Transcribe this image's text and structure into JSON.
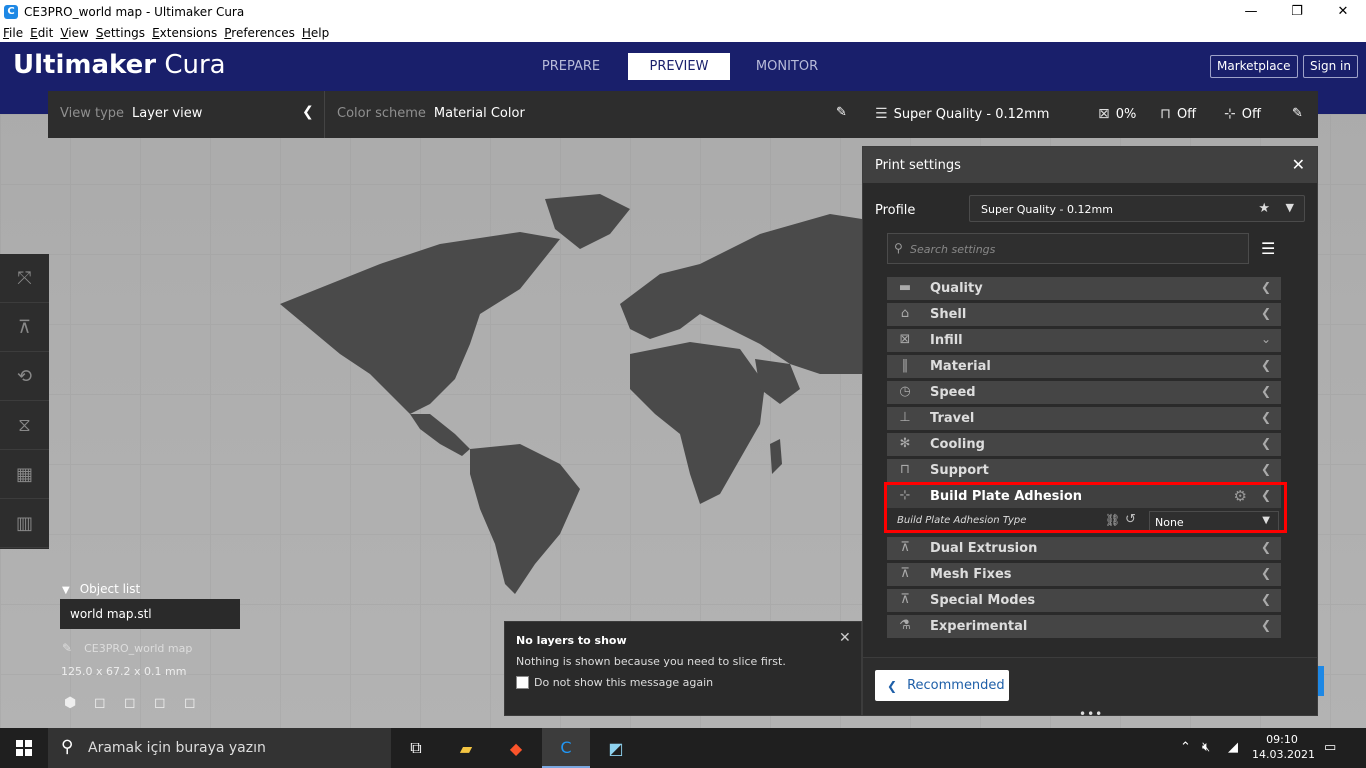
{
  "window": {
    "title": "CE3PRO_world map - Ultimaker Cura",
    "minimize": "—",
    "maximize": "❐",
    "close": "✕"
  },
  "menu": [
    "File",
    "Edit",
    "View",
    "Settings",
    "Extensions",
    "Preferences",
    "Help"
  ],
  "header": {
    "brand_bold": "Ultimaker",
    "brand_light": "Cura",
    "stages": [
      "PREPARE",
      "PREVIEW",
      "MONITOR"
    ],
    "active_stage": "PREVIEW",
    "marketplace": "Marketplace",
    "signin": "Sign in"
  },
  "viewbar": {
    "view_type_label": "View type",
    "view_type_value": "Layer view",
    "color_scheme_label": "Color scheme",
    "color_scheme_value": "Material Color"
  },
  "printbar": {
    "profile": "Super Quality - 0.12mm",
    "infill": "0%",
    "support": "Off",
    "adhesion": "Off"
  },
  "panel": {
    "title": "Print settings",
    "profile_label": "Profile",
    "profile_value": "Super Quality - 0.12mm",
    "search_placeholder": "Search settings",
    "categories": [
      {
        "label": "Quality",
        "icon": "quality-icon",
        "glyph": "▬"
      },
      {
        "label": "Shell",
        "icon": "shell-icon",
        "glyph": "⌂"
      },
      {
        "label": "Infill",
        "icon": "infill-icon",
        "glyph": "⊠"
      },
      {
        "label": "Material",
        "icon": "material-icon",
        "glyph": "‖"
      },
      {
        "label": "Speed",
        "icon": "speed-icon",
        "glyph": "◷"
      },
      {
        "label": "Travel",
        "icon": "travel-icon",
        "glyph": "⊥"
      },
      {
        "label": "Cooling",
        "icon": "cooling-icon",
        "glyph": "✻"
      },
      {
        "label": "Support",
        "icon": "support-icon",
        "glyph": "⊓"
      },
      {
        "label": "Build Plate Adhesion",
        "icon": "adhesion-icon",
        "glyph": "⊹"
      },
      {
        "label": "Dual Extrusion",
        "icon": "dual-extrusion-icon",
        "glyph": "⊼"
      },
      {
        "label": "Mesh Fixes",
        "icon": "mesh-fixes-icon",
        "glyph": "⊼"
      },
      {
        "label": "Special Modes",
        "icon": "special-modes-icon",
        "glyph": "⊼"
      },
      {
        "label": "Experimental",
        "icon": "experimental-icon",
        "glyph": "⚗"
      }
    ],
    "adhesion_setting_label": "Build Plate Adhesion Type",
    "adhesion_setting_value": "None",
    "recommended": "Recommended"
  },
  "objects": {
    "header": "Object list",
    "file": "world map.stl",
    "project": "CE3PRO_world map",
    "dimensions": "125.0 x 67.2 x 0.1 mm"
  },
  "message": {
    "title": "No layers to show",
    "body": "Nothing is shown because you need to slice first.",
    "checkbox": "Do not show this message again"
  },
  "taskbar": {
    "search_placeholder": "Aramak için buraya yazın",
    "time": "09:10",
    "date": "14.03.2021"
  },
  "colors": {
    "header_bg": "#191f6b",
    "panel_bg": "#2a2a2a",
    "highlight": "#ff0000",
    "accent": "#1e88e5"
  }
}
